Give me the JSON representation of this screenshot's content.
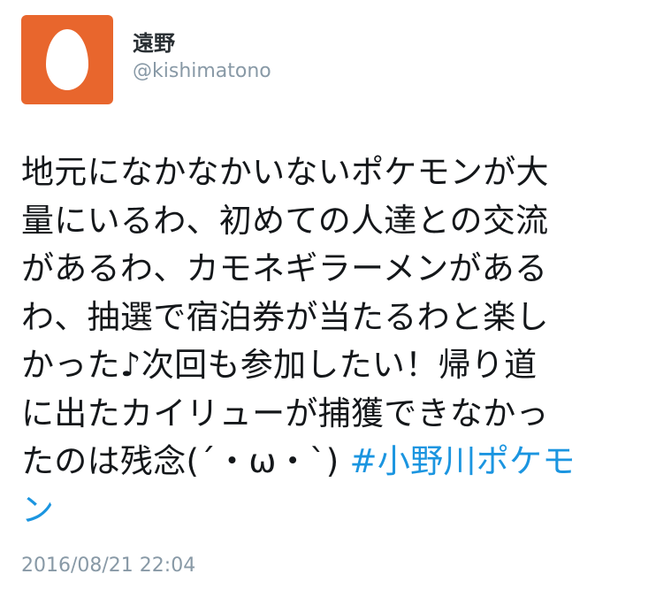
{
  "user": {
    "display_name": "遠野",
    "handle": "@kishimatono",
    "avatar_icon": "default-egg-avatar-icon",
    "avatar_color": "#e8662d"
  },
  "tweet": {
    "lines": [
      "地元になかなかいないポケモンが大",
      "量にいるわ、初めての人達との交流",
      "があるわ、カモネギラーメンがある",
      "わ、抽選で宿泊券が当たるわと楽し",
      "かった♪次回も参加したい！帰り道",
      "に出たカイリューが捕獲できなかっ",
      "たのは残念(´・ω・`) "
    ],
    "hashtag_line7": "#小野川ポケモ",
    "hashtag_line8": "ン",
    "timestamp": "2016/08/21 22:04"
  },
  "colors": {
    "text": "#14171a",
    "secondary": "#8899a6",
    "link": "#1b95e0"
  }
}
